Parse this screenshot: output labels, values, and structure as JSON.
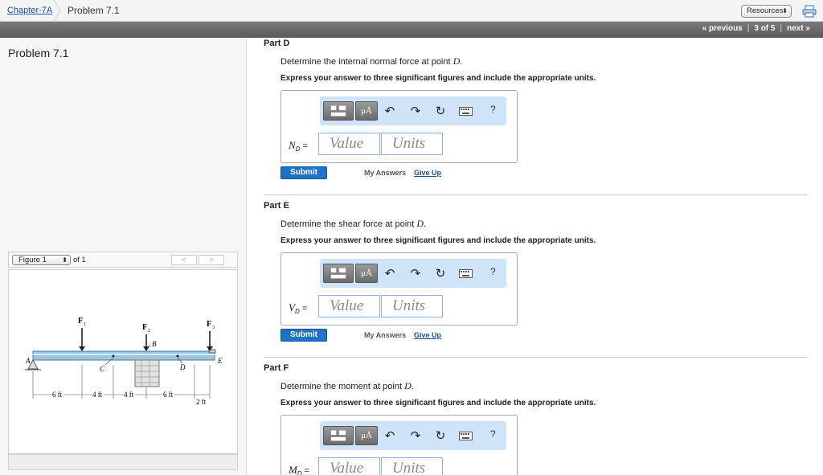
{
  "breadcrumb": {
    "chapter": "Chapter-7A",
    "problem": "Problem 7.1"
  },
  "resources": {
    "label": "Resources",
    "arrow": "⬍"
  },
  "nav": {
    "previous": "« previous",
    "position": "3 of 5",
    "next": "next »",
    "sep": "|"
  },
  "left": {
    "title": "Problem 7.1",
    "figure": {
      "selected": "Figure 1",
      "arrow": "⬍",
      "of": "of 1",
      "prev": "<",
      "next": ">"
    }
  },
  "figure_labels": {
    "F1": "F",
    "F1s": "1",
    "F2": "F",
    "F2s": "2",
    "F3": "F",
    "F3s": "3",
    "A": "A",
    "B": "B",
    "C": "C",
    "D": "D",
    "E": "E",
    "d1": "6 ft",
    "d2": "4 ft",
    "d3": "4 ft",
    "d4": "6 ft",
    "d5": "2 ft"
  },
  "parts": [
    {
      "title": "Part D",
      "question_pre": "Determine the internal normal force at point ",
      "question_var": "D",
      "question_post": ".",
      "express": "Express your answer to three significant figures and include the appropriate units.",
      "var_main": "N",
      "var_sub": "D",
      "eq": " =",
      "value_ph": "Value",
      "units_ph": "Units",
      "submit": "Submit",
      "my_answers": "My Answers",
      "give_up": "Give Up"
    },
    {
      "title": "Part E",
      "question_pre": "Determine the shear force at point ",
      "question_var": "D",
      "question_post": ".",
      "express": "Express your answer to three significant figures and include the appropriate units.",
      "var_main": "V",
      "var_sub": "D",
      "eq": " =",
      "value_ph": "Value",
      "units_ph": "Units",
      "submit": "Submit",
      "my_answers": "My Answers",
      "give_up": "Give Up"
    },
    {
      "title": "Part F",
      "question_pre": "Determine the moment at point ",
      "question_var": "D",
      "question_post": ".",
      "express": "Express your answer to three significant figures and include the appropriate units.",
      "var_main": "M",
      "var_sub": "D",
      "eq": " =",
      "value_ph": "Value",
      "units_ph": "Units"
    }
  ],
  "toolbar": {
    "mu": "μÅ",
    "undo": "↶",
    "redo": "↷",
    "reset": "↻",
    "help": "?"
  },
  "colors": {
    "accent": "#1f72c8",
    "toolbar_bg": "#cfe4f8",
    "navbar": "#6a6a6a"
  }
}
